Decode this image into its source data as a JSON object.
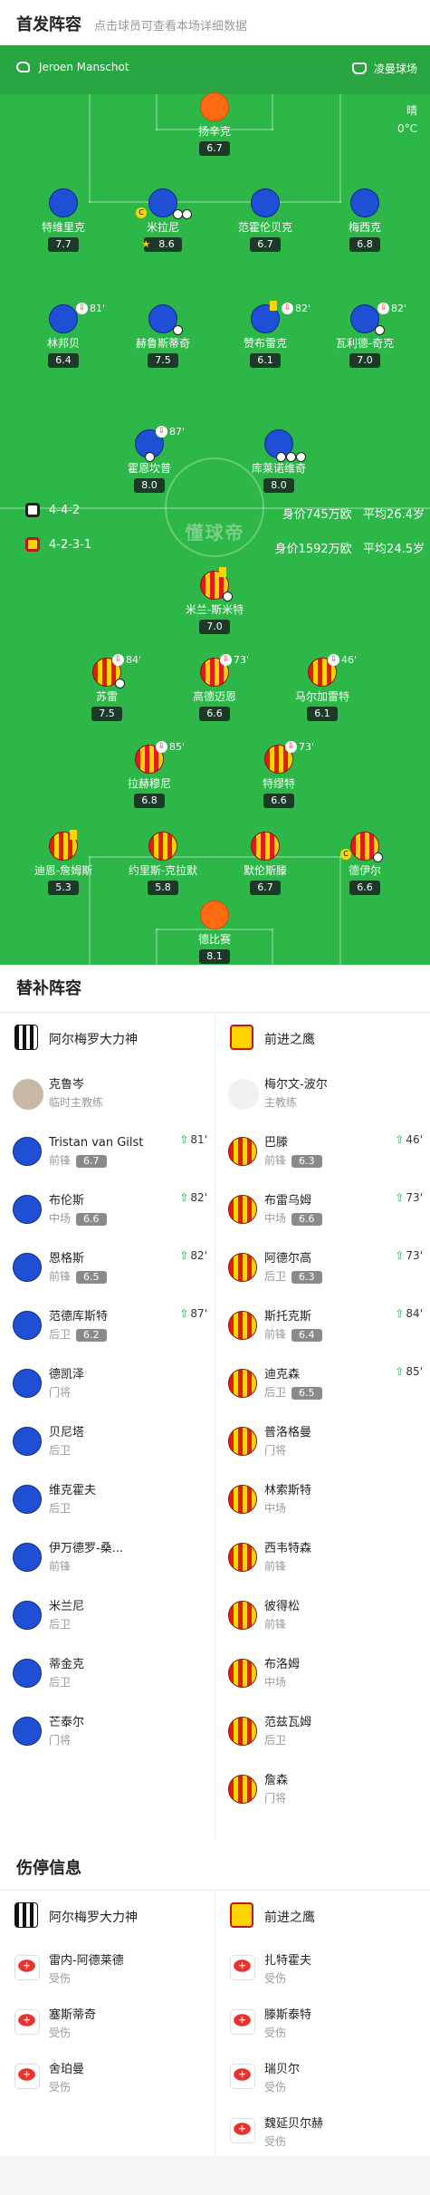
{
  "header": {
    "title": "首发阵容",
    "subtitle": "点击球员可查看本场详细数据"
  },
  "pitch": {
    "referee": "Jeroen Manschot",
    "venue": "凌曼球场",
    "weather": "晴",
    "temperature": "0°C",
    "watermark": "懂球帝"
  },
  "home_starters": [
    {
      "name": "扬辛克",
      "rating": "6.7"
    },
    {
      "name": "特维里克",
      "rating": "7.7"
    },
    {
      "name": "米拉尼",
      "rating": "8.6"
    },
    {
      "name": "范霍伦贝克",
      "rating": "6.7"
    },
    {
      "name": "梅西克",
      "rating": "6.8"
    },
    {
      "name": "林邦贝",
      "rating": "6.4",
      "sub": "81'"
    },
    {
      "name": "赫鲁斯蒂奇",
      "rating": "7.5"
    },
    {
      "name": "赞布雷克",
      "rating": "6.1",
      "sub": "82'"
    },
    {
      "name": "瓦利德-奇克",
      "rating": "7.0",
      "sub": "82'"
    },
    {
      "name": "霍恩坎普",
      "rating": "8.0",
      "sub": "87'"
    },
    {
      "name": "库莱诺维奇",
      "rating": "8.0"
    }
  ],
  "away_starters": [
    {
      "name": "米兰-斯米特",
      "rating": "7.0"
    },
    {
      "name": "苏雷",
      "rating": "7.5",
      "sub": "84'"
    },
    {
      "name": "高德迈恩",
      "rating": "6.6",
      "sub": "73'"
    },
    {
      "name": "马尔加雷特",
      "rating": "6.1",
      "sub": "46'"
    },
    {
      "name": "拉赫穆尼",
      "rating": "6.8",
      "sub": "85'"
    },
    {
      "name": "特缪特",
      "rating": "6.6",
      "sub": "73'"
    },
    {
      "name": "迪恩-詹姆斯",
      "rating": "5.3"
    },
    {
      "name": "约里斯-克拉默",
      "rating": "5.8"
    },
    {
      "name": "默伦斯滕",
      "rating": "6.7"
    },
    {
      "name": "德伊尔",
      "rating": "6.6"
    },
    {
      "name": "德比赛",
      "rating": "8.1"
    }
  ],
  "formations": {
    "home": {
      "formation": "4-4-2",
      "value": "身价745万欧",
      "age": "平均26.4岁"
    },
    "away": {
      "formation": "4-2-3-1",
      "value": "身价1592万欧",
      "age": "平均24.5岁"
    }
  },
  "subs_section": {
    "title": "替补阵容",
    "home_team": "阿尔梅罗大力神",
    "away_team": "前进之鹰",
    "home_coach": {
      "name": "克鲁岑",
      "role": "临时主教练"
    },
    "away_coach": {
      "name": "梅尔文-波尔",
      "role": "主教练"
    },
    "home_subs": [
      {
        "name": "Tristan van Gilst",
        "pos": "前锋",
        "rating": "6.7",
        "min": "81'"
      },
      {
        "name": "布伦斯",
        "pos": "中场",
        "rating": "6.6",
        "min": "82'"
      },
      {
        "name": "恩格斯",
        "pos": "前锋",
        "rating": "6.5",
        "min": "82'"
      },
      {
        "name": "范德库斯特",
        "pos": "后卫",
        "rating": "6.2",
        "min": "87'"
      },
      {
        "name": "德凯泽",
        "pos": "门将"
      },
      {
        "name": "贝尼塔",
        "pos": "后卫"
      },
      {
        "name": "维克霍夫",
        "pos": "后卫"
      },
      {
        "name": "伊万德罗-桑...",
        "pos": "前锋"
      },
      {
        "name": "米兰尼",
        "pos": "后卫"
      },
      {
        "name": "蒂金克",
        "pos": "后卫"
      },
      {
        "name": "芒泰尔",
        "pos": "门将"
      }
    ],
    "away_subs": [
      {
        "name": "巴滕",
        "pos": "前锋",
        "rating": "6.3",
        "min": "46'"
      },
      {
        "name": "布雷乌姆",
        "pos": "中场",
        "rating": "6.6",
        "min": "73'"
      },
      {
        "name": "阿德尔高",
        "pos": "后卫",
        "rating": "6.3",
        "min": "73'"
      },
      {
        "name": "斯托克斯",
        "pos": "前锋",
        "rating": "6.4",
        "min": "84'"
      },
      {
        "name": "迪克森",
        "pos": "后卫",
        "rating": "6.5",
        "min": "85'"
      },
      {
        "name": "普洛格曼",
        "pos": "门将"
      },
      {
        "name": "林索斯特",
        "pos": "中场"
      },
      {
        "name": "西韦特森",
        "pos": "前锋"
      },
      {
        "name": "彼得松",
        "pos": "前锋"
      },
      {
        "name": "布洛姆",
        "pos": "中场"
      },
      {
        "name": "范兹瓦姆",
        "pos": "后卫"
      },
      {
        "name": "詹森",
        "pos": "门将"
      }
    ]
  },
  "injury_section": {
    "title": "伤停信息",
    "home_team": "阿尔梅罗大力神",
    "away_team": "前进之鹰",
    "home": [
      {
        "name": "雷内-阿德莱德",
        "status": "受伤"
      },
      {
        "name": "塞斯蒂奇",
        "status": "受伤"
      },
      {
        "name": "舍珀曼",
        "status": "受伤"
      }
    ],
    "away": [
      {
        "name": "扎特霍夫",
        "status": "受伤"
      },
      {
        "name": "滕斯泰特",
        "status": "受伤"
      },
      {
        "name": "瑞贝尔",
        "status": "受伤"
      },
      {
        "name": "魏延贝尔赫",
        "status": "受伤"
      }
    ]
  },
  "colors": {
    "pitch": "#2db748",
    "home_kit": "#1f4fd4",
    "home_gk": "#ff6a13",
    "away_kit_red": "#e01b1b",
    "away_kit_yellow": "#ffd400",
    "rating_box": "#1c3a27",
    "sub_arrow": "#26b04a"
  },
  "icons": [
    "whistle-icon",
    "stadium-icon",
    "sub-off-icon",
    "goal-ball-icon",
    "captain-icon",
    "yellow-card-icon",
    "star-icon",
    "sub-on-arrow-icon",
    "injury-kit-icon"
  ]
}
